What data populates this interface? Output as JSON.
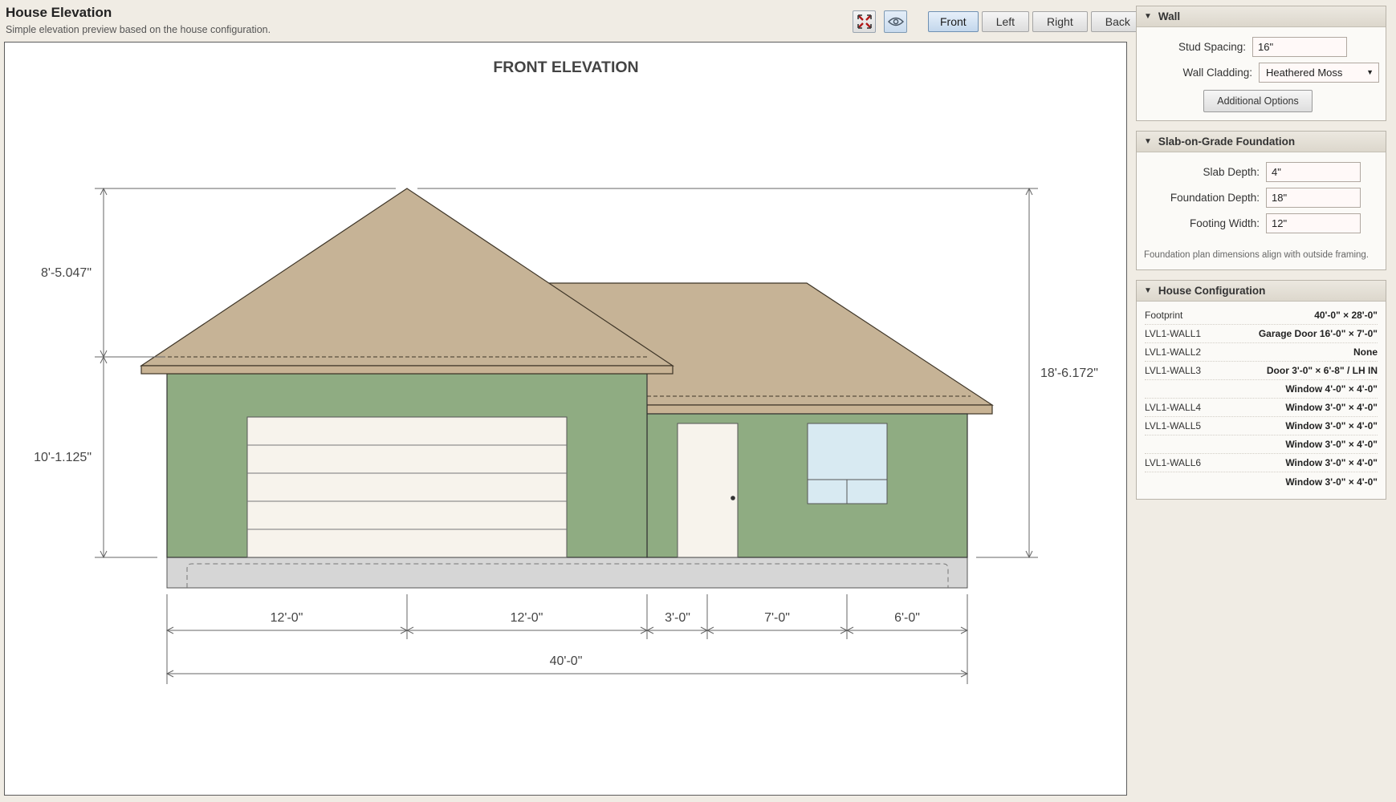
{
  "header": {
    "title": "House Elevation",
    "subtitle": "Simple elevation preview based on the house configuration."
  },
  "toolbar": {
    "views": [
      "Front",
      "Left",
      "Right",
      "Back"
    ],
    "active_view": "Front"
  },
  "elevation": {
    "title": "FRONT ELEVATION",
    "dims": {
      "roof_height": "8'-5.047\"",
      "wall_height": "10'-1.125\"",
      "total_height": "18'-6.172\"",
      "seg1": "12'-0\"",
      "seg2": "12'-0\"",
      "seg3": "3'-0\"",
      "seg4": "7'-0\"",
      "seg5": "6'-0\"",
      "overall": "40'-0\""
    },
    "colors": {
      "wall": "#8fac82",
      "roof": "#c6b396",
      "trim": "#c8b394",
      "door": "#f7f3ec",
      "window": "#d8eaf2",
      "foundation": "#d6d6d6"
    }
  },
  "wall_panel": {
    "title": "Wall",
    "stud_spacing_label": "Stud Spacing:",
    "stud_spacing": "16\"",
    "cladding_label": "Wall Cladding:",
    "cladding": "Heathered Moss",
    "options_button": "Additional Options"
  },
  "foundation_panel": {
    "title": "Slab-on-Grade Foundation",
    "slab_depth_label": "Slab Depth:",
    "slab_depth": "4\"",
    "foundation_depth_label": "Foundation Depth:",
    "foundation_depth": "18\"",
    "footing_width_label": "Footing Width:",
    "footing_width": "12\"",
    "note": "Foundation plan dimensions align with outside framing."
  },
  "config_panel": {
    "title": "House Configuration",
    "rows": [
      {
        "key": "Footprint",
        "value": "40'-0\" × 28'-0\""
      },
      {
        "key": "LVL1-WALL1",
        "value": "Garage Door 16'-0\" × 7'-0\""
      },
      {
        "key": "LVL1-WALL2",
        "value": "None"
      },
      {
        "key": "LVL1-WALL3",
        "value": "Door 3'-0\" × 6'-8\" / LH IN"
      },
      {
        "key": "",
        "value": "Window 4'-0\" × 4'-0\""
      },
      {
        "key": "LVL1-WALL4",
        "value": "Window 3'-0\" × 4'-0\""
      },
      {
        "key": "LVL1-WALL5",
        "value": "Window 3'-0\" × 4'-0\""
      },
      {
        "key": "",
        "value": "Window 3'-0\" × 4'-0\""
      },
      {
        "key": "LVL1-WALL6",
        "value": "Window 3'-0\" × 4'-0\""
      },
      {
        "key": "",
        "value": "Window 3'-0\" × 4'-0\""
      }
    ]
  }
}
